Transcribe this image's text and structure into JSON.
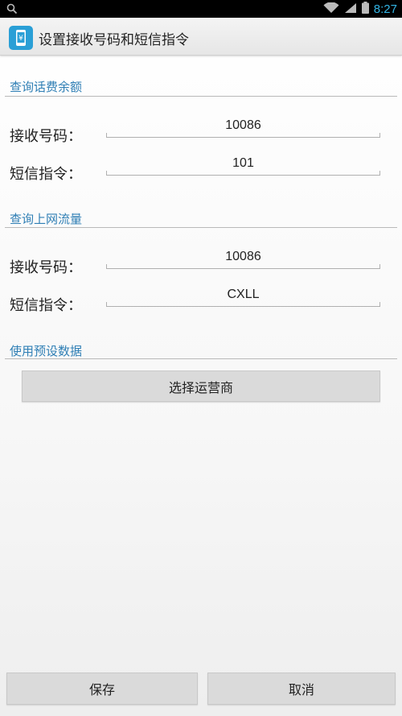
{
  "status_bar": {
    "time": "8:27"
  },
  "app": {
    "title": "设置接收号码和短信指令"
  },
  "sections": [
    {
      "title": "查询话费余额",
      "fields": [
        {
          "label": "接收号码：",
          "value": "10086"
        },
        {
          "label": "短信指令：",
          "value": "101"
        }
      ]
    },
    {
      "title": "查询上网流量",
      "fields": [
        {
          "label": "接收号码：",
          "value": "10086"
        },
        {
          "label": "短信指令：",
          "value": "CXLL"
        }
      ]
    },
    {
      "title": "使用预设数据",
      "button": "选择运营商"
    }
  ],
  "footer": {
    "save_label": "保存",
    "cancel_label": "取消"
  },
  "colors": {
    "accent": "#33b5e5",
    "section_title": "#2f7fb5",
    "app_icon": "#2a9fd6"
  }
}
